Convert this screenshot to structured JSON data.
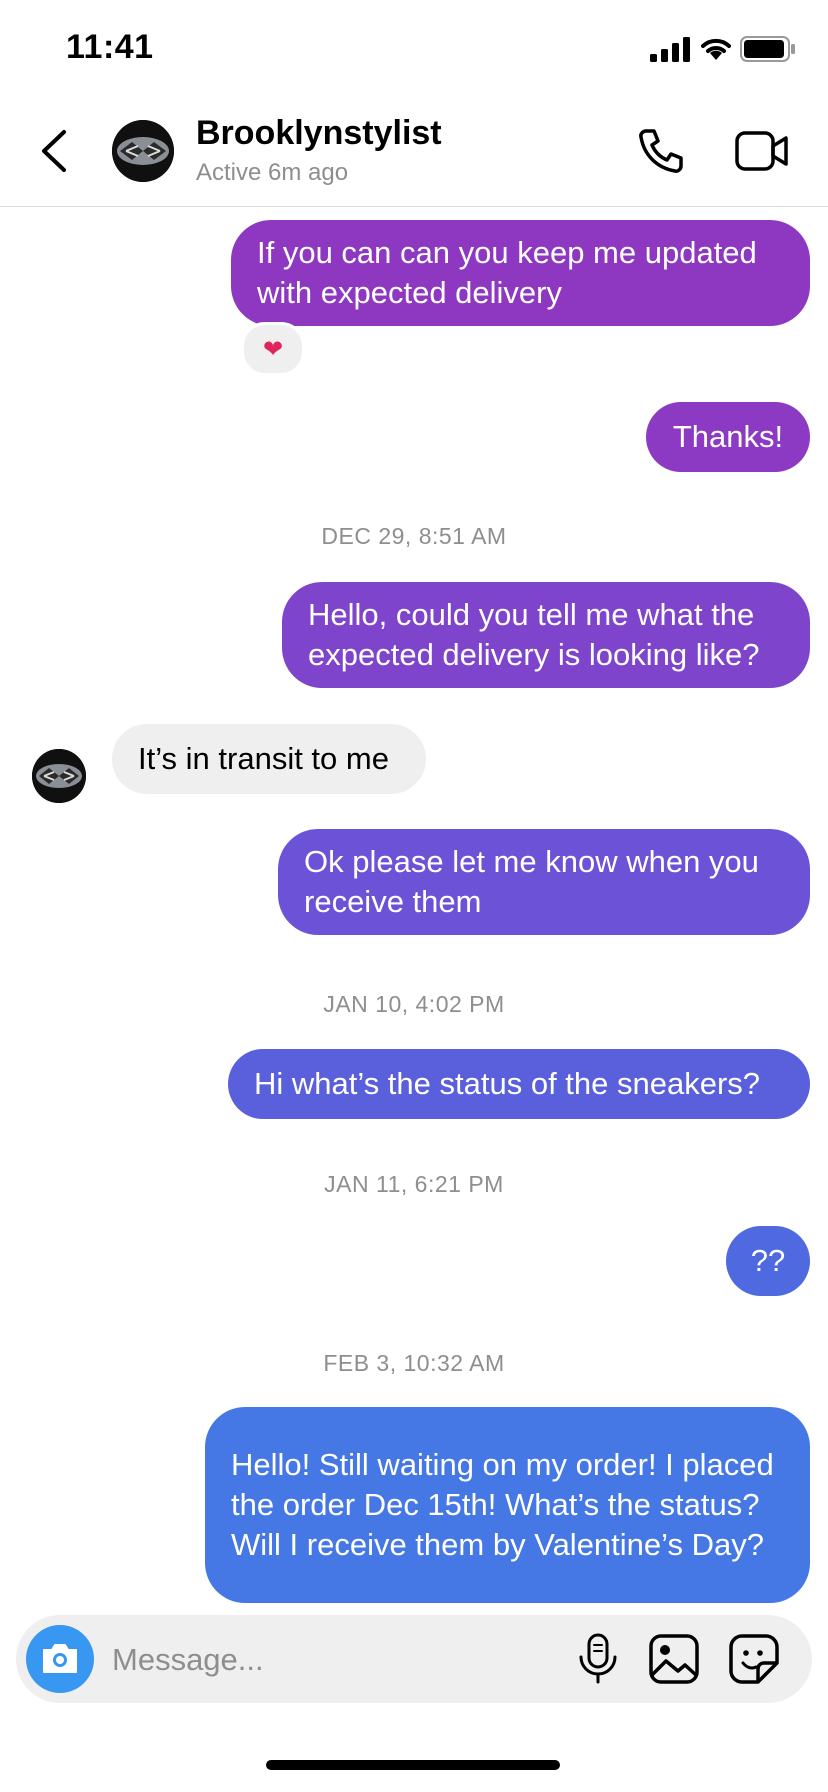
{
  "status_bar": {
    "time": "11:41"
  },
  "header": {
    "name": "Brooklynstylist",
    "status": "Active 6m ago"
  },
  "messages": [
    {
      "type": "outgoing",
      "text": "If you can can you keep me updated with expected delivery",
      "reaction": "❤"
    },
    {
      "type": "outgoing",
      "text": "Thanks!"
    },
    {
      "type": "timestamp",
      "text": "DEC 29, 8:51 AM"
    },
    {
      "type": "outgoing",
      "text": "Hello, could you tell me what the expected delivery is looking like?"
    },
    {
      "type": "incoming",
      "text": "It’s in transit to me"
    },
    {
      "type": "outgoing",
      "text": "Ok please let me know when you receive them"
    },
    {
      "type": "timestamp",
      "text": "JAN 10, 4:02 PM"
    },
    {
      "type": "outgoing",
      "text": "Hi what’s the status of the sneakers?"
    },
    {
      "type": "timestamp",
      "text": "JAN 11, 6:21 PM"
    },
    {
      "type": "outgoing",
      "text": "??"
    },
    {
      "type": "timestamp",
      "text": "FEB 3, 10:32 AM"
    },
    {
      "type": "outgoing",
      "text": "Hello! Still waiting on my order! I placed the order Dec 15th! What’s the status? Will I receive them by Valentine’s Day?"
    }
  ],
  "composer": {
    "placeholder": "Message..."
  },
  "icons": {
    "back": "chevron-left-icon",
    "phone": "phone-icon",
    "video": "video-camera-icon",
    "camera": "camera-icon",
    "mic": "microphone-icon",
    "gallery": "image-icon",
    "sticker": "sticker-icon",
    "reaction": "heart-icon"
  },
  "colors": {
    "bubble_gradient_top": "#9038C3",
    "bubble_gradient_bottom": "#3E82E8",
    "incoming_bubble": "#EFEFEF",
    "camera_button": "#3897F0"
  }
}
